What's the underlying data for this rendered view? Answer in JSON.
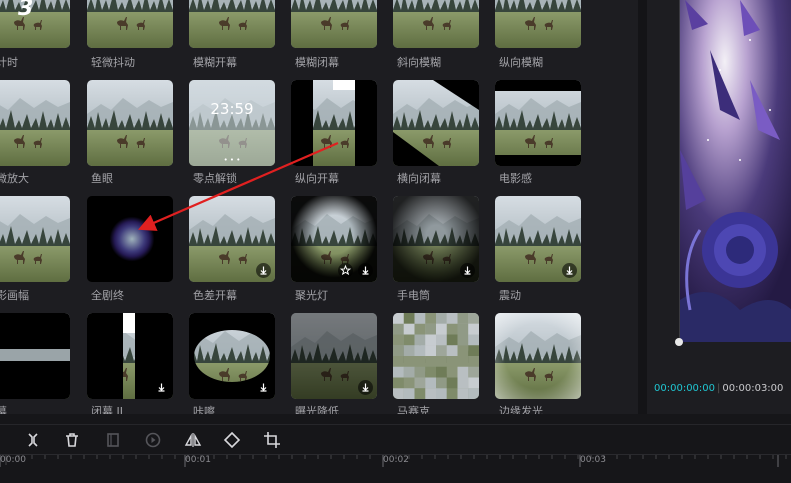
{
  "effects_grid": {
    "top_row_fragment": "3",
    "rows": [
      [
        "计时",
        "轻微抖动",
        "模糊开幕",
        "模糊闭幕",
        "斜向模糊",
        "纵向模糊"
      ],
      [
        "微放大",
        "鱼眼",
        "零点解锁",
        "纵向开幕",
        "横向闭幕",
        "电影感"
      ],
      [
        "影画幅",
        "全剧终",
        "色差开幕",
        "聚光灯",
        "手电筒",
        "震动"
      ],
      [
        "幕",
        "闭幕 II",
        "咔嚓",
        "曝光降低",
        "马赛克",
        "边缘发光"
      ]
    ],
    "lock_clock": "23:59",
    "lock_dots": "• • •"
  },
  "preview": {
    "current_time": "00:00:00:00",
    "separator": "|",
    "total_time": "00:00:03:00"
  },
  "toolbar": {
    "icons": [
      "split-icon",
      "delete-icon",
      "freeze-icon",
      "reverse-play-icon",
      "mirror-icon",
      "rotate-icon",
      "crop-icon"
    ]
  },
  "timeline": {
    "marks": [
      "00:00",
      "00:01",
      "00:02",
      "00:03"
    ]
  },
  "colors": {
    "accent_cyan": "#20c5d1",
    "annotation_red": "#e02020"
  }
}
